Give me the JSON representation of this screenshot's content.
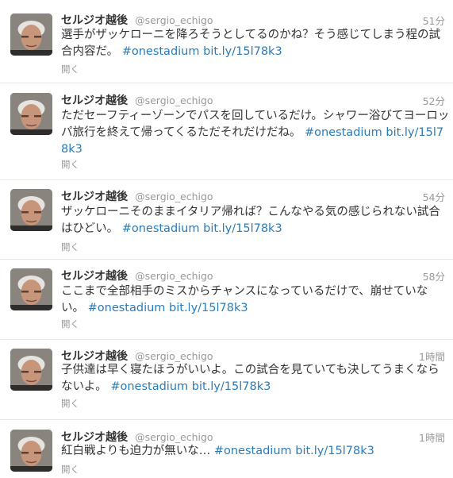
{
  "timeline": {
    "tweets": [
      {
        "name": "セルジオ越後",
        "handle": "@sergio_echigo",
        "time": "51分",
        "text": "選手がザッケローニを降ろそうとしてるのかね？そう感じてしまう程の試合内容だ。",
        "hashtag": "#onestadium",
        "link": "bit.ly/15l78k3",
        "expand": "開く"
      },
      {
        "name": "セルジオ越後",
        "handle": "@sergio_echigo",
        "time": "52分",
        "text": "ただセーフティーゾーンでパスを回しているだけ。シャワー浴びてヨーロッパ旅行を終えて帰ってくるただそれだけだね。",
        "hashtag": "#onestadium",
        "link": "bit.ly/15l78k3",
        "expand": "開く"
      },
      {
        "name": "セルジオ越後",
        "handle": "@sergio_echigo",
        "time": "54分",
        "text": "ザッケローニそのままイタリア帰れば？こんなやる気の感じられない試合はひどい。",
        "hashtag": "#onestadium",
        "link": "bit.ly/15l78k3",
        "expand": "開く"
      },
      {
        "name": "セルジオ越後",
        "handle": "@sergio_echigo",
        "time": "58分",
        "text": "ここまで全部相手のミスからチャンスになっているだけで、崩せていない。",
        "hashtag": "#onestadium",
        "link": "bit.ly/15l78k3",
        "expand": "開く"
      },
      {
        "name": "セルジオ越後",
        "handle": "@sergio_echigo",
        "time": "1時間",
        "text": "子供達は早く寝たほうがいいよ。この試合を見ていても決してうまくならないよ。",
        "hashtag": "#onestadium",
        "link": "bit.ly/15l78k3",
        "expand": "開く"
      },
      {
        "name": "セルジオ越後",
        "handle": "@sergio_echigo",
        "time": "1時間",
        "text": "紅白戦よりも迫力が無いな…",
        "hashtag": "#onestadium",
        "link": "bit.ly/15l78k3",
        "expand": "開く"
      }
    ]
  },
  "colors": {
    "link": "#2b7bb9",
    "meta": "#999999",
    "text": "#333333",
    "divider": "#e8e8e8"
  }
}
